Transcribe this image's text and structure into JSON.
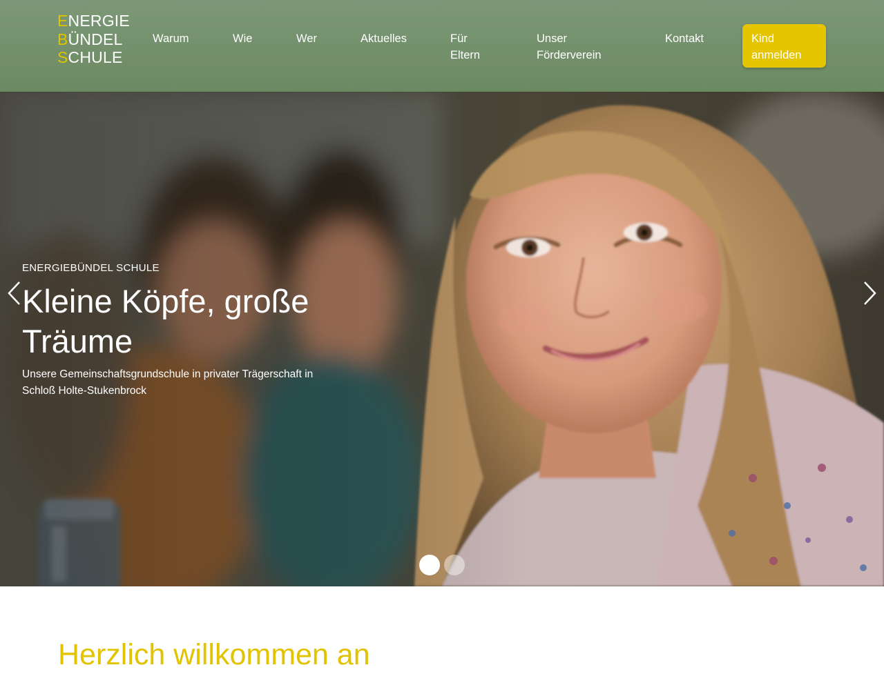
{
  "brand": {
    "logo_lines": [
      {
        "initial": "E",
        "rest": "NERGIE"
      },
      {
        "initial": "B",
        "rest": "ÜNDEL"
      },
      {
        "initial": "S",
        "rest": "CHULE"
      }
    ]
  },
  "nav": {
    "items": [
      {
        "line1": "Warum",
        "line2": ""
      },
      {
        "line1": "Wie",
        "line2": ""
      },
      {
        "line1": "Wer",
        "line2": ""
      },
      {
        "line1": "Aktuelles",
        "line2": ""
      },
      {
        "line1": "Für",
        "line2": "Eltern"
      },
      {
        "line1": "Unser",
        "line2": "Förderverein"
      },
      {
        "line1": "Kontakt",
        "line2": ""
      }
    ],
    "cta": {
      "line1": "Kind",
      "line2": "anmelden"
    }
  },
  "hero": {
    "eyebrow": "ENERGIEBÜNDEL SCHULE",
    "headline": "Kleine Köpfe, große Träume",
    "subline": "Unsere Gemeinschaftsgrundschule in privater Trägerschaft in Schloß Holte-Stukenbrock",
    "slide_count": 2,
    "active_slide": 1,
    "prev_icon": "chevron-left-icon",
    "next_icon": "chevron-right-icon"
  },
  "welcome": {
    "heading": "Herzlich willkommen an"
  },
  "colors": {
    "header_green": "#74915f",
    "accent_yellow": "#e5c400",
    "text_white": "#ffffff"
  }
}
